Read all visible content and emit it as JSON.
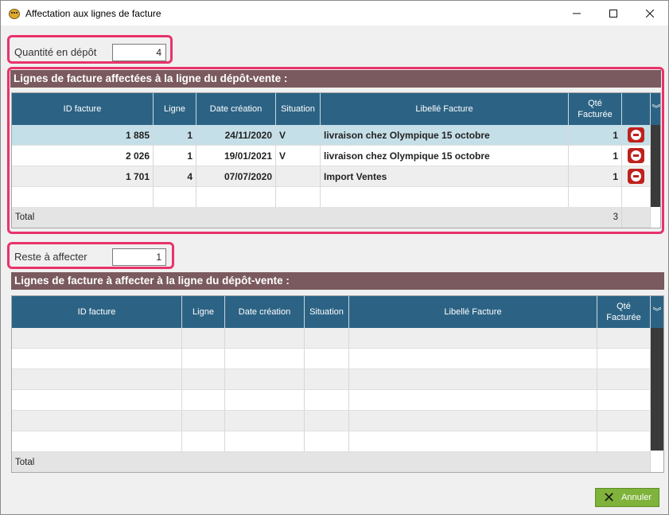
{
  "window": {
    "title": "Affectation aux lignes de facture"
  },
  "titlebar": {
    "minimize_icon": "minimize-icon",
    "maximize_icon": "maximize-icon",
    "close_icon": "close-icon"
  },
  "quantite": {
    "label": "Quantité en dépôt",
    "value": "4"
  },
  "reste": {
    "label": "Reste à affecter",
    "value": "1"
  },
  "affected": {
    "header": "Lignes de facture affectées à la ligne du dépôt-vente :",
    "columns": [
      "ID facture",
      "Ligne",
      "Date création",
      "Situation",
      "Libellé Facture",
      "Qté Facturée"
    ],
    "rows": [
      {
        "id": "1 885",
        "ligne": "1",
        "date": "24/11/2020",
        "situation": "V",
        "libelle": "livraison chez Olympique 15 octobre",
        "qte": "1"
      },
      {
        "id": "2 026",
        "ligne": "1",
        "date": "19/01/2021",
        "situation": "V",
        "libelle": "livraison chez Olympique 15 octobre",
        "qte": "1"
      },
      {
        "id": "1 701",
        "ligne": "4",
        "date": "07/07/2020",
        "situation": "",
        "libelle": "Import Ventes",
        "qte": "1"
      }
    ],
    "total_label": "Total",
    "total_qte": "3"
  },
  "to_affect": {
    "header": "Lignes de facture à affecter à la ligne du dépôt-vente :",
    "columns": [
      "ID facture",
      "Ligne",
      "Date création",
      "Situation",
      "Libellé Facture",
      "Qté Facturée"
    ],
    "total_label": "Total"
  },
  "buttons": {
    "cancel": "Annuler"
  },
  "colors": {
    "grid_header": "#2c6384",
    "section_header": "#7a5a5e",
    "highlight": "#e8336b",
    "cancel_button": "#7fb33b",
    "delete_button": "#c0211c"
  }
}
